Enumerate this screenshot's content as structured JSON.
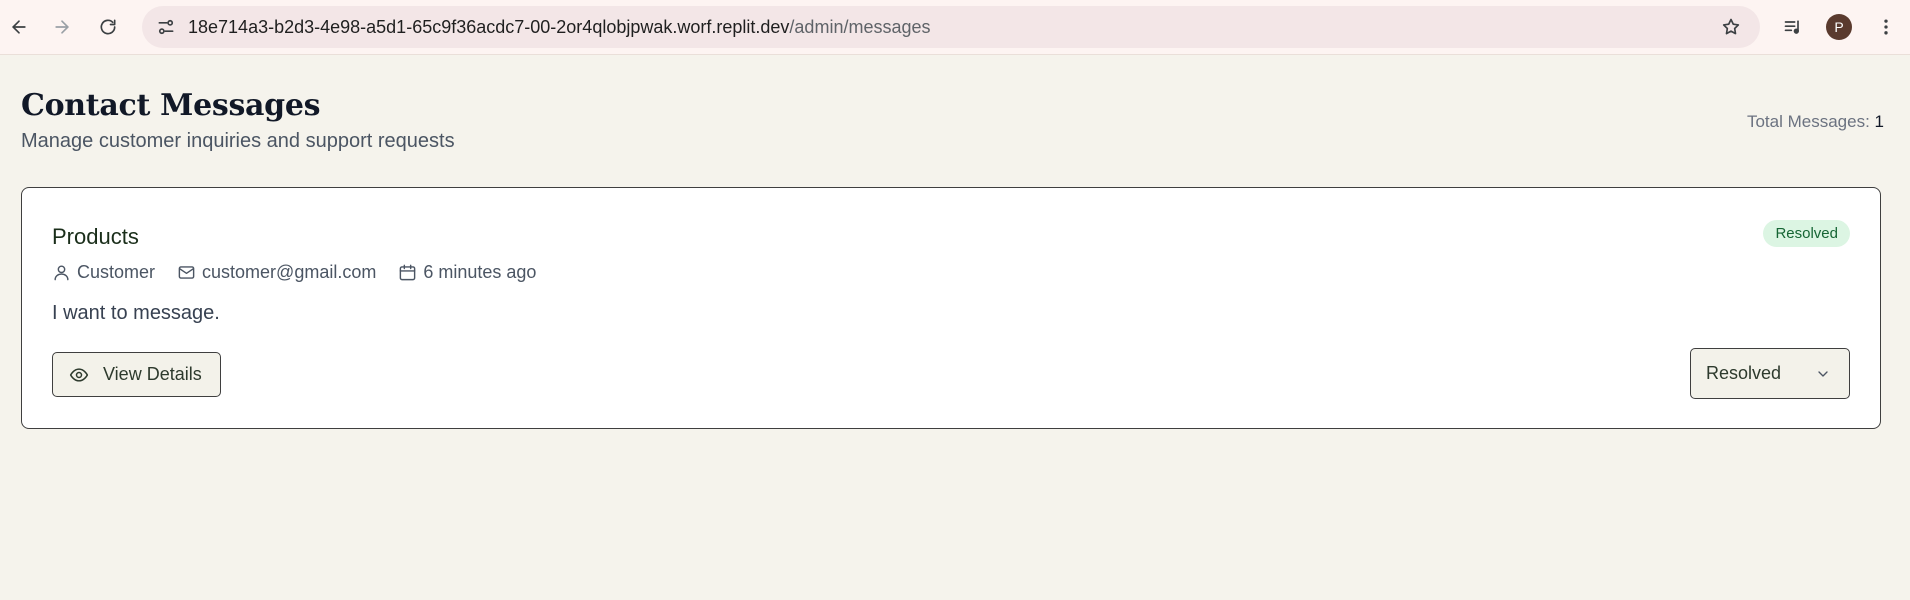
{
  "browser": {
    "url_host": "18e714a3-b2d3-4e98-a5d1-65c9f36acdc7-00-2or4qlobjpwak.worf.replit.dev",
    "url_path": "/admin/messages",
    "profile_initial": "P",
    "icons": {
      "back": "arrow-left-icon",
      "forward": "arrow-right-icon",
      "reload": "reload-icon",
      "site_info": "tune-icon",
      "bookmark": "star-icon",
      "media": "media-queue-icon",
      "menu": "kebab-menu-icon"
    }
  },
  "header": {
    "title": "Contact Messages",
    "subtitle": "Manage customer inquiries and support requests",
    "total_label": "Total Messages: ",
    "total_count": "1"
  },
  "messages": [
    {
      "subject": "Products",
      "status_badge": "Resolved",
      "name": "Customer",
      "email": "customer@gmail.com",
      "time": "6 minutes ago",
      "body": "I want to message.",
      "view_button_label": "View Details",
      "status_selected": "Resolved"
    }
  ],
  "colors": {
    "page_bg": "#f5f3ec",
    "card_bg": "#ffffff",
    "badge_bg": "#dcf5e3",
    "badge_text": "#166534",
    "button_bg": "#f3f2ea"
  }
}
